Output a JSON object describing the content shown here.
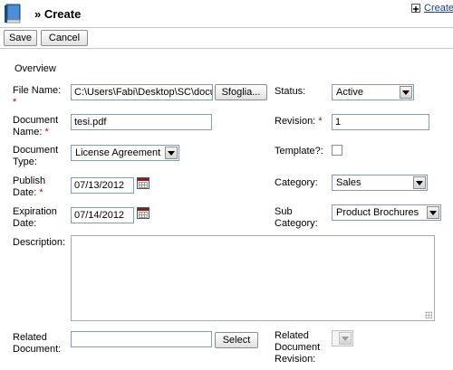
{
  "header": {
    "title": "» Create",
    "create_link": "Create",
    "icon": "book-icon",
    "plus_icon": "plus-icon"
  },
  "toolbar": {
    "save_label": "Save",
    "cancel_label": "Cancel"
  },
  "form": {
    "section": "Overview",
    "file_name": {
      "label_line1": "File Name:",
      "label_req": "*",
      "value": "C:\\Users\\Fabi\\Desktop\\SC\\docu",
      "browse_label": "Sfoglia..."
    },
    "status": {
      "label": "Status:",
      "value": "Active"
    },
    "document_name": {
      "label_line1": "Document",
      "label_line2": "Name:",
      "label_req": "*",
      "value": "tesi.pdf"
    },
    "revision": {
      "label": "Revision:",
      "label_req": "*",
      "value": "1"
    },
    "document_type": {
      "label_line1": "Document",
      "label_line2": "Type:",
      "value": "License Agreement"
    },
    "template": {
      "label": "Template?:"
    },
    "publish_date": {
      "label_line1": "Publish",
      "label_line2": "Date:",
      "label_req": "*",
      "value": "07/13/2012"
    },
    "category": {
      "label": "Category:",
      "value": "Sales"
    },
    "expiration_date": {
      "label_line1": "Expiration",
      "label_line2": "Date:",
      "value": "07/14/2012"
    },
    "sub_category": {
      "label_line1": "Sub",
      "label_line2": "Category:",
      "value": "Product Brochures"
    },
    "description": {
      "label": "Description:",
      "value": ""
    },
    "related_document": {
      "label_line1": "Related",
      "label_line2": "Document:",
      "value": "",
      "select_label": "Select"
    },
    "related_revision": {
      "label_line1": "Related",
      "label_line2": "Document",
      "label_line3": "Revision:"
    }
  },
  "colors": {
    "required": "#cc0000",
    "border": "#7f9db9"
  }
}
